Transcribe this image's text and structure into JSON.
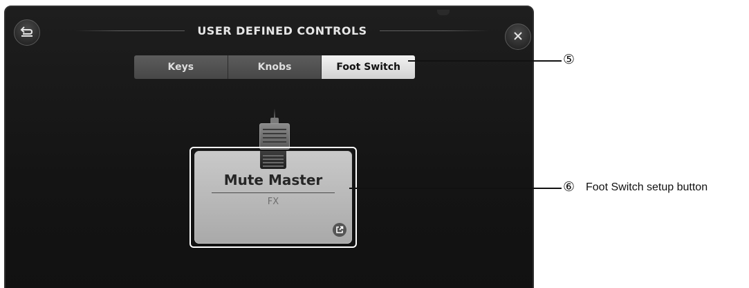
{
  "header": {
    "title": "USER DEFINED CONTROLS",
    "back_icon": "return-icon",
    "close_icon": "close-icon"
  },
  "tabs": [
    {
      "label": "Keys",
      "active": false
    },
    {
      "label": "Knobs",
      "active": false
    },
    {
      "label": "Foot Switch",
      "active": true
    }
  ],
  "foot_switch": {
    "name": "Mute Master",
    "sub": "FX",
    "edit_icon": "external-edit-icon"
  },
  "callouts": [
    {
      "number": "⑤",
      "text": ""
    },
    {
      "number": "⑥",
      "text": "Foot Switch setup button"
    }
  ],
  "colors": {
    "screen_bg": "#141414",
    "tab_active_bg": "#e6e6e6",
    "tab_inactive_bg": "#525252",
    "button_bg": "#bdbdbd"
  }
}
